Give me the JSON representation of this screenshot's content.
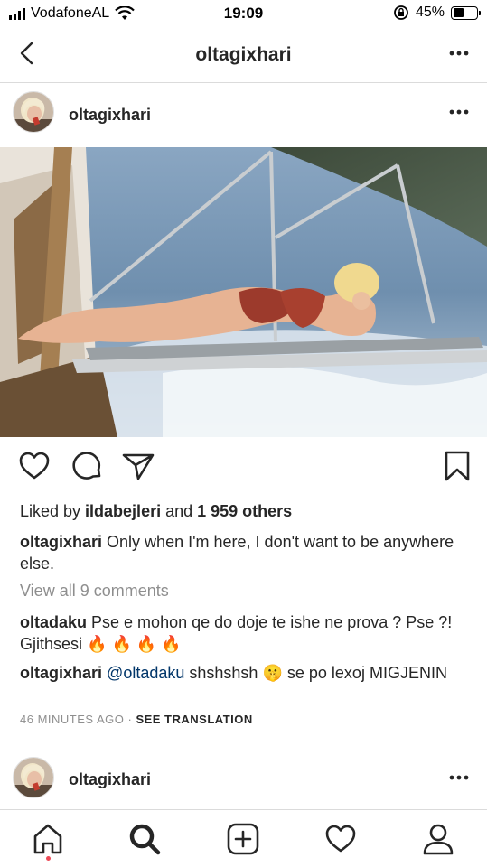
{
  "status_bar": {
    "carrier": "VodafoneAL",
    "time": "19:09",
    "battery_percent": "45%",
    "battery_level": 0.45
  },
  "nav": {
    "title": "oltagixhari"
  },
  "post": {
    "username": "oltagixhari",
    "likes": {
      "prefix": "Liked by ",
      "user": "ildabejleri",
      "middle": " and ",
      "count": "1 959 others"
    },
    "caption": {
      "user": "oltagixhari",
      "text": "Only when I'm here, I don't want to be anywhere else."
    },
    "view_all_comments": "View all 9 comments",
    "comments": [
      {
        "user": "oltadaku",
        "text": "Pse e mohon qe do doje te ishe ne prova ? Pse ?! Gjithsesi",
        "emoji": "🔥 🔥 🔥 🔥"
      },
      {
        "user": "oltagixhari",
        "mention": "@oltadaku",
        "text": "shshshsh",
        "emoji": "🤫",
        "text_after": "se po lexoj MIGJENIN"
      }
    ],
    "time_ago": "46 MINUTES AGO",
    "separator": " · ",
    "see_translation": "SEE TRANSLATION"
  },
  "next_post": {
    "username": "oltagixhari"
  },
  "icons": {
    "back": "chevron-left-icon",
    "more": "more-horizontal-icon",
    "like": "heart-icon",
    "comment": "comment-icon",
    "share": "send-icon",
    "save": "bookmark-icon",
    "home": "home-icon",
    "search": "search-icon",
    "new_post": "add-post-icon",
    "activity": "heart-icon",
    "profile": "profile-icon"
  },
  "colors": {
    "text": "#262626",
    "secondary": "#8e8e8e",
    "mention": "#003569",
    "divider": "#dbdbdb",
    "notification_dot": "#ed4956"
  }
}
